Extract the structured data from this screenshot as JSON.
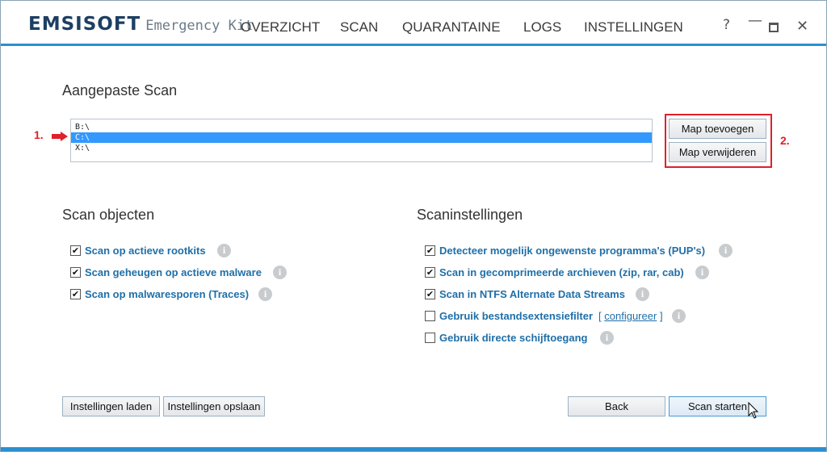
{
  "app": {
    "brand": "EMSISOFT",
    "subtitle": "Emergency Kit"
  },
  "nav": {
    "items": [
      "OVERZICHT",
      "SCAN",
      "QUARANTAINE",
      "LOGS",
      "INSTELLINGEN"
    ]
  },
  "window_controls": {
    "help": "?",
    "minimize": "—",
    "close": "✕"
  },
  "custom_scan": {
    "title": "Aangepaste Scan",
    "paths": [
      "B:\\",
      "C:\\",
      "X:\\"
    ],
    "selected_path": "C:\\",
    "add_button": "Map toevoegen",
    "remove_button": "Map verwijderen",
    "annotation_1": "1.",
    "annotation_2": "2."
  },
  "scan_objects": {
    "title": "Scan objecten",
    "options": [
      {
        "label": "Scan op actieve rootkits",
        "checked": true
      },
      {
        "label": "Scan geheugen op actieve malware",
        "checked": true
      },
      {
        "label": "Scan op malwaresporen (Traces)",
        "checked": true
      }
    ]
  },
  "scan_settings": {
    "title": "Scaninstellingen",
    "options": [
      {
        "label": "Detecteer mogelijk ongewenste programma's (PUP's)",
        "checked": true
      },
      {
        "label": "Scan in gecomprimeerde archieven (zip, rar, cab)",
        "checked": true
      },
      {
        "label": "Scan in NTFS Alternate Data Streams",
        "checked": true
      },
      {
        "label": "Gebruik bestandsextensiefilter",
        "checked": false,
        "link_open": "[",
        "link": "configureer",
        "link_close": "]"
      },
      {
        "label": "Gebruik directe schijftoegang",
        "checked": false
      }
    ]
  },
  "footer": {
    "load_settings": "Instellingen laden",
    "save_settings": "Instellingen opslaan",
    "back": "Back",
    "start_scan": "Scan starten"
  },
  "info_glyph": "i",
  "check_glyph": "✔",
  "colors": {
    "accent": "#2c8fd0",
    "link": "#1f6fa8",
    "selection": "#3399ff",
    "annotation": "#e0202a"
  }
}
